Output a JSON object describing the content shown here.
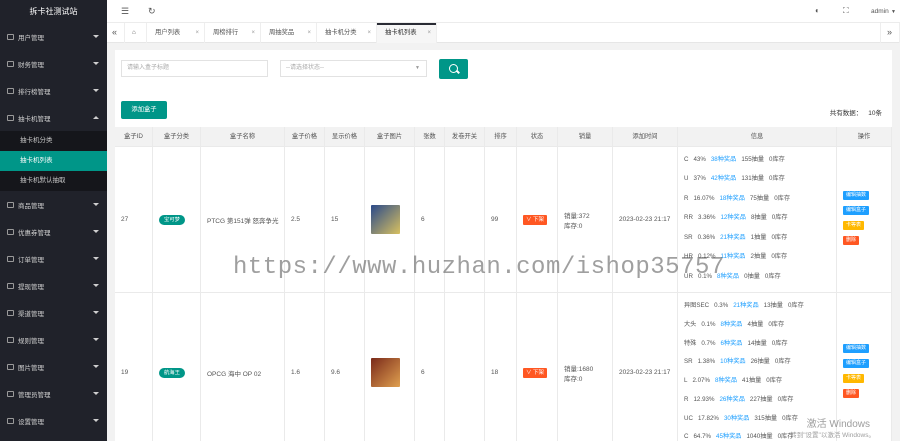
{
  "app": {
    "title": "拆卡社测试站"
  },
  "sidebar": {
    "items": [
      "用户管理",
      "财务管理",
      "排行榜管理",
      "抽卡机管理",
      "商品管理",
      "优惠券管理",
      "订单管理",
      "提现管理",
      "渠道管理",
      "规则管理",
      "图片管理",
      "管理员管理",
      "设置管理"
    ],
    "sub": [
      "抽卡机分类",
      "抽卡机列表",
      "抽卡机默认抽取"
    ]
  },
  "header": {
    "menu_glyph": "☰",
    "refresh_glyph": "↻",
    "theme_glyph": "◐",
    "fullscreen_glyph": "⛶",
    "user": "admin",
    "user_caret": "▼"
  },
  "tabs": {
    "prev_glyph": "«",
    "next_glyph": "»",
    "home_glyph": "⌂",
    "close_glyph": "×",
    "items": [
      "用户列表",
      "周榜排行",
      "周抽奖品",
      "抽卡机分类",
      "抽卡机列表"
    ]
  },
  "filters": {
    "title_placeholder": "请输入盒子标题",
    "status_placeholder": "--请选择状态--",
    "caret": "▼"
  },
  "toolbar": {
    "add_label": "添加盒子",
    "total_label": "共有数据：",
    "total_value": "10条"
  },
  "table": {
    "columns": [
      "盒子ID",
      "盒子分类",
      "盒子名称",
      "盒子价格",
      "显示价格",
      "盒子图片",
      "张数",
      "发卷开关",
      "排序",
      "状态",
      "销量",
      "添加时间",
      "信息",
      "操作"
    ],
    "rows": [
      {
        "id": "27",
        "category": "宝可梦",
        "name": "PTCG 第151弹 怒奔争光",
        "price": "2.5",
        "show_price": "15",
        "count": "6",
        "switch": "",
        "sort": "99",
        "status": "下架",
        "sales": [
          "销量:372",
          "库存:0"
        ],
        "added": "2023-02-23 21:17",
        "info": [
          [
            "C",
            "43%",
            "38种奖品",
            "155抽量",
            "0库存"
          ],
          [
            "U",
            "37%",
            "42种奖品",
            "131抽量",
            "0库存"
          ],
          [
            "R",
            "16.07%",
            "18种奖品",
            "75抽量",
            "0库存"
          ],
          [
            "RR",
            "3.36%",
            "12种奖品",
            "8抽量",
            "0库存"
          ],
          [
            "SR",
            "0.36%",
            "21种奖品",
            "1抽量",
            "0库存"
          ],
          [
            "HR",
            "0.12%",
            "11种奖品",
            "2抽量",
            "0库存"
          ],
          [
            "UR",
            "0.1%",
            "8种奖品",
            "0抽量",
            "0库存"
          ]
        ],
        "actions": [
          "编辑抽数",
          "编辑盒子",
          "卡等表",
          "删除"
        ]
      },
      {
        "id": "19",
        "category": "航海王",
        "name": "OPCG 海中 OP 02",
        "price": "1.6",
        "show_price": "9.6",
        "count": "6",
        "switch": "",
        "sort": "18",
        "status": "下架",
        "sales": [
          "销量:1680",
          "库存:0"
        ],
        "added": "2023-02-23 21:17",
        "info": [
          [
            "异图SEC",
            "0.3%",
            "21种奖品",
            "13抽量",
            "0库存"
          ],
          [
            "大头",
            "0.1%",
            "8种奖品",
            "4抽量",
            "0库存"
          ],
          [
            "特殊",
            "0.7%",
            "6种奖品",
            "14抽量",
            "0库存"
          ],
          [
            "SR",
            "1.38%",
            "10种奖品",
            "26抽量",
            "0库存"
          ],
          [
            "L",
            "2.07%",
            "8种奖品",
            "41抽量",
            "0库存"
          ],
          [
            "R",
            "12.93%",
            "26种奖品",
            "227抽量",
            "0库存"
          ],
          [
            "UC",
            "17.82%",
            "30种奖品",
            "315抽量",
            "0库存"
          ],
          [
            "C",
            "64.7%",
            "45种奖品",
            "1040抽量",
            "0库存"
          ]
        ],
        "actions": [
          "编辑抽数",
          "编辑盒子",
          "卡等表",
          "删除"
        ]
      }
    ]
  },
  "overlay": {
    "watermark": "https://www.huzhan.com/ishop35757",
    "win_title": "激活 Windows",
    "win_hint": "转到\"设置\"以激活 Windows。"
  },
  "colors": {
    "primary": "#009688",
    "sidebar": "#20222a",
    "link": "#1e9fff",
    "danger": "#ff5722",
    "warning": "#ffb800"
  }
}
